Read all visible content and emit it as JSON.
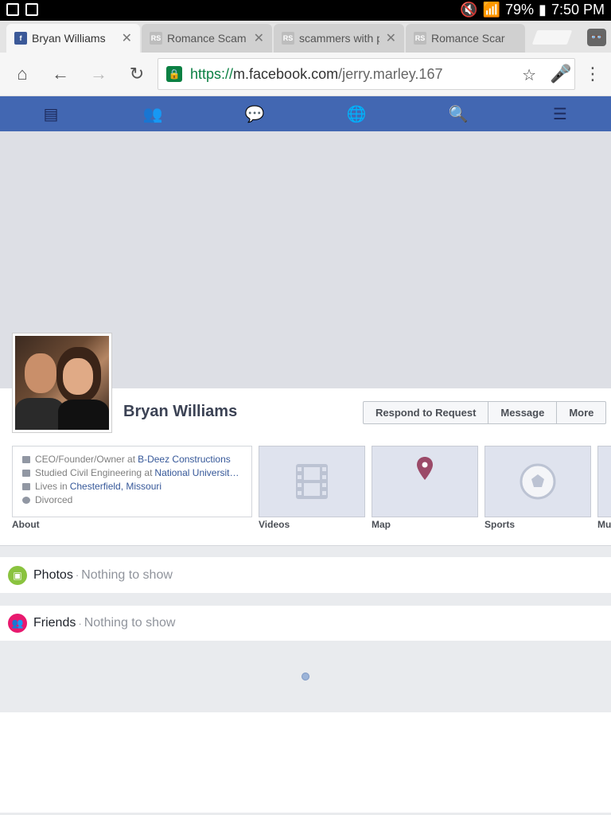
{
  "status_bar": {
    "battery": "79%",
    "time": "7:50 PM"
  },
  "tabs": [
    {
      "title": "Bryan Williams",
      "active": true,
      "favicon": "facebook-favicon"
    },
    {
      "title": "Romance Scam",
      "active": false,
      "favicon": "rs-favicon"
    },
    {
      "title": "scammers with p",
      "active": false,
      "favicon": "rs-favicon"
    },
    {
      "title": "Romance Scar",
      "active": false,
      "favicon": "rs-favicon"
    }
  ],
  "omnibox": {
    "scheme": "https://",
    "host": "m.facebook.com",
    "path": "/jerry.marley.167"
  },
  "profile": {
    "name": "Bryan Williams",
    "actions": {
      "respond": "Respond to Request",
      "message": "Message",
      "more": "More"
    }
  },
  "about": {
    "work_prefix": "CEO/Founder/Owner at",
    "work_link": "B-Deez Constructions",
    "edu_prefix": "Studied Civil Engineering at",
    "edu_link": "National University ...",
    "lives_prefix": "Lives in",
    "lives_link": "Chesterfield, Missouri",
    "relationship": "Divorced",
    "label": "About"
  },
  "tiles": {
    "videos": "Videos",
    "map": "Map",
    "sports": "Sports",
    "music": "Mu"
  },
  "sections": {
    "photos_title": "Photos",
    "photos_empty": "Nothing to show",
    "friends_title": "Friends",
    "friends_empty": "Nothing to show",
    "separator": "·"
  },
  "colors": {
    "fb_blue": "#4267b2",
    "link": "#365899",
    "photos_accent": "#8ac33f",
    "friends_accent": "#e8196e"
  }
}
